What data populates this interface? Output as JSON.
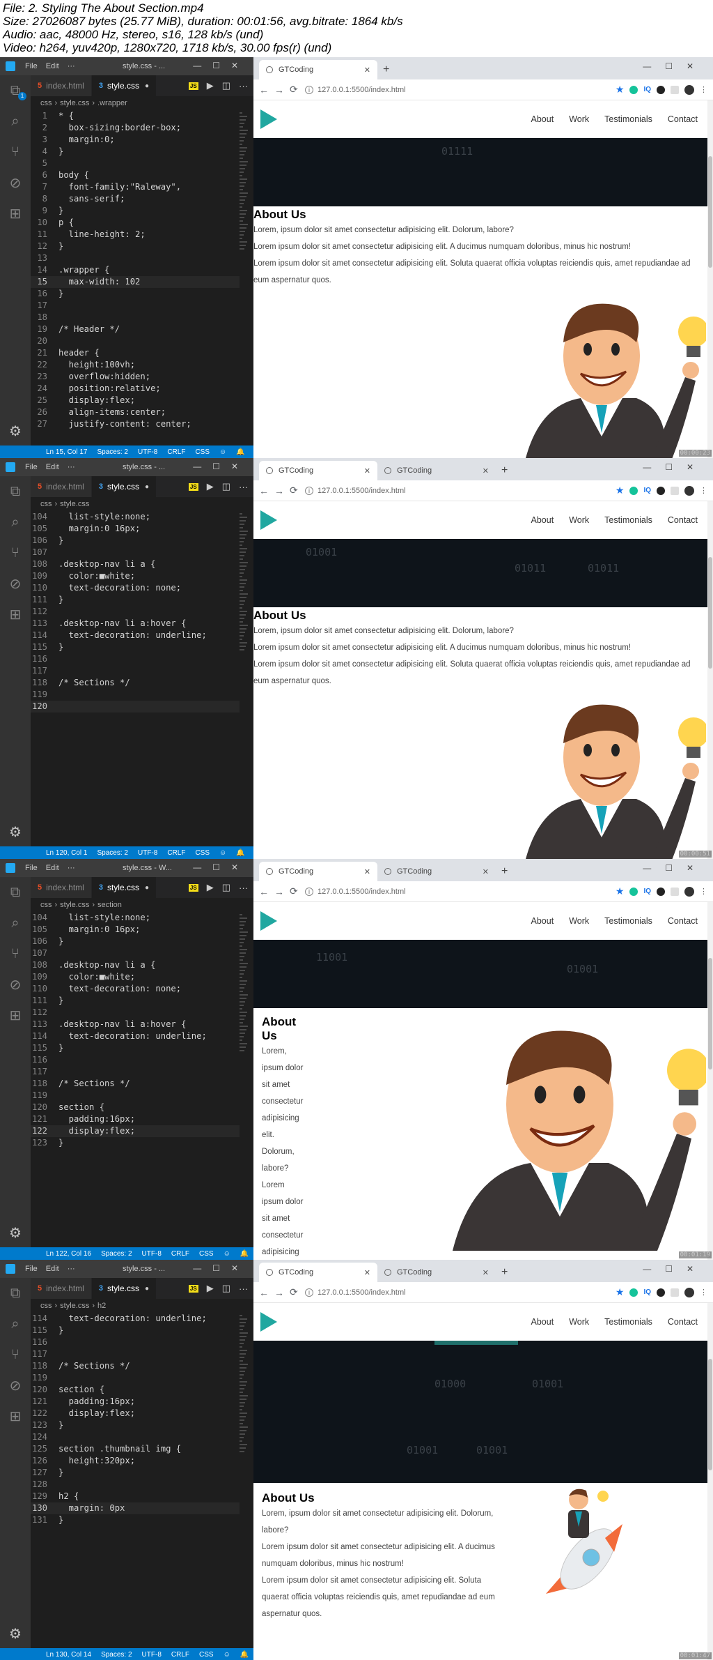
{
  "file_info": {
    "line1": "File: 2. Styling The About Section.mp4",
    "line2": "Size: 27026087 bytes (25.77 MiB), duration: 00:01:56, avg.bitrate: 1864 kb/s",
    "line3": "Audio: aac, 48000 Hz, stereo, s16, 128 kb/s (und)",
    "line4": "Video: h264, yuv420p, 1280x720, 1718 kb/s, 30.00 fps(r) (und)"
  },
  "vscode": {
    "menu": [
      "File",
      "Edit",
      "···"
    ],
    "tab_html": "index.html",
    "tab_css": "style.css",
    "crumb_file": "style.css",
    "crumb_prefix": "css"
  },
  "browser": {
    "tab1": "GTCoding",
    "tab2": "GTCoding",
    "url": "127.0.0.1:5500/index.html",
    "nav": [
      "About",
      "Work",
      "Testimonials",
      "Contact"
    ],
    "about_title": "About Us",
    "p1": "Lorem, ipsum dolor sit amet consectetur adipisicing elit. Dolorum, labore?",
    "p2": "Lorem ipsum dolor sit amet consectetur adipisicing elit. A ducimus numquam doloribus, minus hic nostrum!",
    "p3": "Lorem ipsum dolor sit amet consectetur adipisicing elit. Soluta quaerat officia voluptas reiciendis quis, amet repudiandae ad eum aspernatur quos."
  },
  "frames": [
    {
      "window_title": "style.css - ...",
      "crumb_tail": ".wrapper",
      "status": [
        "Ln 15, Col 17",
        "Spaces: 2",
        "UTF-8",
        "CRLF",
        "CSS"
      ],
      "timestamp": "00:00:23",
      "lines": [
        {
          "n": "1",
          "t": "* {"
        },
        {
          "n": "2",
          "t": "  box-sizing:border-box;"
        },
        {
          "n": "3",
          "t": "  margin:0;"
        },
        {
          "n": "4",
          "t": "}"
        },
        {
          "n": "5",
          "t": ""
        },
        {
          "n": "6",
          "t": "body {"
        },
        {
          "n": "7",
          "t": "  font-family:\"Raleway\","
        },
        {
          "n": "8",
          "t": "  sans-serif;"
        },
        {
          "n": "9",
          "t": "}"
        },
        {
          "n": "10",
          "t": "p {"
        },
        {
          "n": "11",
          "t": "  line-height: 2;"
        },
        {
          "n": "12",
          "t": "}"
        },
        {
          "n": "13",
          "t": ""
        },
        {
          "n": "14",
          "t": ".wrapper {"
        },
        {
          "n": "15",
          "t": "  max-width: 102"
        },
        {
          "n": "16",
          "t": "}"
        },
        {
          "n": "17",
          "t": ""
        },
        {
          "n": "18",
          "t": ""
        },
        {
          "n": "19",
          "t": "/* Header */"
        },
        {
          "n": "20",
          "t": ""
        },
        {
          "n": "21",
          "t": "header {"
        },
        {
          "n": "22",
          "t": "  height:100vh;"
        },
        {
          "n": "23",
          "t": "  overflow:hidden;"
        },
        {
          "n": "24",
          "t": "  position:relative;"
        },
        {
          "n": "25",
          "t": "  display:flex;"
        },
        {
          "n": "26",
          "t": "  align-items:center;"
        },
        {
          "n": "27",
          "t": "  justify-content: center;"
        }
      ]
    },
    {
      "window_title": "style.css - ...",
      "crumb_tail": "",
      "status": [
        "Ln 120, Col 1",
        "Spaces: 2",
        "UTF-8",
        "CRLF",
        "CSS"
      ],
      "timestamp": "00:00:51",
      "lines": [
        {
          "n": "104",
          "t": "  list-style:none;"
        },
        {
          "n": "105",
          "t": "  margin:0 16px;"
        },
        {
          "n": "106",
          "t": "}"
        },
        {
          "n": "107",
          "t": ""
        },
        {
          "n": "108",
          "t": ".desktop-nav li a {"
        },
        {
          "n": "109",
          "t": "  color:■white;"
        },
        {
          "n": "110",
          "t": "  text-decoration: none;"
        },
        {
          "n": "111",
          "t": "}"
        },
        {
          "n": "112",
          "t": ""
        },
        {
          "n": "113",
          "t": ".desktop-nav li a:hover {"
        },
        {
          "n": "114",
          "t": "  text-decoration: underline;"
        },
        {
          "n": "115",
          "t": "}"
        },
        {
          "n": "116",
          "t": ""
        },
        {
          "n": "117",
          "t": ""
        },
        {
          "n": "118",
          "t": "/* Sections */"
        },
        {
          "n": "119",
          "t": ""
        },
        {
          "n": "120",
          "t": ""
        }
      ]
    },
    {
      "window_title": "style.css - W...",
      "crumb_tail": "section",
      "status": [
        "Ln 122, Col 16",
        "Spaces: 2",
        "UTF-8",
        "CRLF",
        "CSS"
      ],
      "timestamp": "00:01:19",
      "lines": [
        {
          "n": "104",
          "t": "  list-style:none;"
        },
        {
          "n": "105",
          "t": "  margin:0 16px;"
        },
        {
          "n": "106",
          "t": "}"
        },
        {
          "n": "107",
          "t": ""
        },
        {
          "n": "108",
          "t": ".desktop-nav li a {"
        },
        {
          "n": "109",
          "t": "  color:■white;"
        },
        {
          "n": "110",
          "t": "  text-decoration: none;"
        },
        {
          "n": "111",
          "t": "}"
        },
        {
          "n": "112",
          "t": ""
        },
        {
          "n": "113",
          "t": ".desktop-nav li a:hover {"
        },
        {
          "n": "114",
          "t": "  text-decoration: underline;"
        },
        {
          "n": "115",
          "t": "}"
        },
        {
          "n": "116",
          "t": ""
        },
        {
          "n": "117",
          "t": ""
        },
        {
          "n": "118",
          "t": "/* Sections */"
        },
        {
          "n": "119",
          "t": ""
        },
        {
          "n": "120",
          "t": "section {"
        },
        {
          "n": "121",
          "t": "  padding:16px;"
        },
        {
          "n": "122",
          "t": "  display:flex;"
        },
        {
          "n": "123",
          "t": "}"
        }
      ]
    },
    {
      "window_title": "style.css - ...",
      "crumb_tail": "h2",
      "status": [
        "Ln 130, Col 14",
        "Spaces: 2",
        "UTF-8",
        "CRLF",
        "CSS"
      ],
      "timestamp": "00:01:47",
      "lines": [
        {
          "n": "114",
          "t": "  text-decoration: underline;"
        },
        {
          "n": "115",
          "t": "}"
        },
        {
          "n": "116",
          "t": ""
        },
        {
          "n": "117",
          "t": ""
        },
        {
          "n": "118",
          "t": "/* Sections */"
        },
        {
          "n": "119",
          "t": ""
        },
        {
          "n": "120",
          "t": "section {"
        },
        {
          "n": "121",
          "t": "  padding:16px;"
        },
        {
          "n": "122",
          "t": "  display:flex;"
        },
        {
          "n": "123",
          "t": "}"
        },
        {
          "n": "124",
          "t": ""
        },
        {
          "n": "125",
          "t": "section .thumbnail img {"
        },
        {
          "n": "126",
          "t": "  height:320px;"
        },
        {
          "n": "127",
          "t": "}"
        },
        {
          "n": "128",
          "t": ""
        },
        {
          "n": "129",
          "t": "h2 {"
        },
        {
          "n": "130",
          "t": "  margin: 0px"
        },
        {
          "n": "131",
          "t": "}"
        }
      ]
    }
  ],
  "narrow_about_words": [
    "Lorem,",
    "ipsum dolor",
    "sit amet",
    "consectetur",
    "adipisicing",
    "elit.",
    "Dolorum,",
    "labore?",
    "Lorem",
    "ipsum dolor",
    "sit amet",
    "consectetur",
    "adipisicing"
  ],
  "hero_bits": [
    "01111",
    "01001",
    "01001",
    "01011",
    "01011",
    "11001",
    "01001",
    "01000",
    "01001",
    "01001"
  ]
}
